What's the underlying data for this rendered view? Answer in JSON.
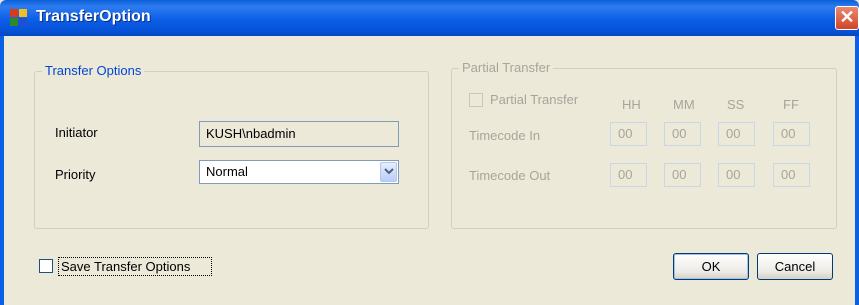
{
  "window": {
    "title": "TransferOption",
    "close_glyph": "✕",
    "app_icon": "app-window-icon"
  },
  "transfer_options": {
    "legend": "Transfer Options",
    "initiator_label": "Initiator",
    "initiator_value": "KUSH\\nbadmin",
    "priority_label": "Priority",
    "priority_value": "Normal"
  },
  "partial_transfer": {
    "legend": "Partial Transfer",
    "checkbox_label": "Partial Transfer",
    "checked": false,
    "columns": [
      "HH",
      "MM",
      "SS",
      "FF"
    ],
    "timecode_in_label": "Timecode In",
    "timecode_in": [
      "00",
      "00",
      "00",
      "00"
    ],
    "timecode_out_label": "Timecode Out",
    "timecode_out": [
      "00",
      "00",
      "00",
      "00"
    ]
  },
  "footer": {
    "save_label": "Save Transfer Options",
    "save_checked": false,
    "ok_label": "OK",
    "cancel_label": "Cancel"
  },
  "colors": {
    "title_bar": "#0b5ee6",
    "accent_text": "#0046d5",
    "disabled_text": "#a7a59b",
    "dialog_bg": "#ece9d8"
  }
}
